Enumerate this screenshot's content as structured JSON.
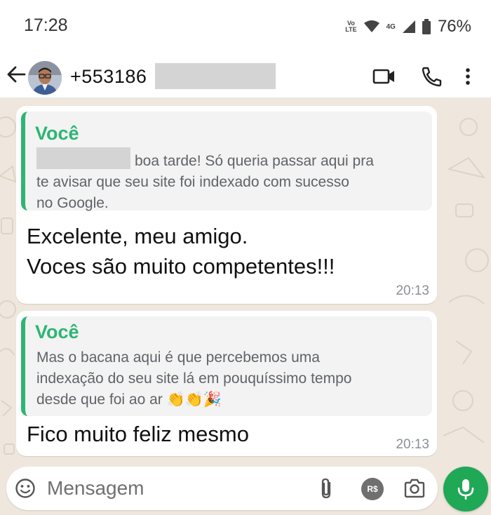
{
  "status_bar": {
    "time": "17:28",
    "volte_line1": "Vo",
    "volte_line2": "LTE",
    "network": "4G",
    "battery": "76%"
  },
  "header": {
    "contact_visible": "+553186",
    "icons": [
      "back-arrow-icon",
      "avatar",
      "video-call-icon",
      "phone-icon",
      "more-vert-icon"
    ]
  },
  "messages": [
    {
      "quote_author": "Você",
      "quote_text_after_redaction": "boa tarde! Só queria passar aqui pra",
      "quote_lines": [
        "te avisar que seu site foi indexado com sucesso",
        "no Google."
      ],
      "text_lines": [
        "Excelente, meu amigo.",
        "Voces são muito competentes!!!"
      ],
      "time": "20:13"
    },
    {
      "quote_author": "Você",
      "quote_lines": [
        "Mas o bacana aqui é que percebemos uma",
        "indexação do seu site lá em pouquíssimo tempo",
        "desde que foi ao ar 👏👏🎉"
      ],
      "text_lines": [
        "Fico muito feliz mesmo"
      ],
      "time": "20:13"
    }
  ],
  "composer": {
    "placeholder": "Mensagem",
    "pay_label": "R$"
  },
  "colors": {
    "accent_green": "#2bb673",
    "mic_green": "#1fa855",
    "chat_background": "#efe7dd",
    "redaction_gray": "#d4d4d4"
  }
}
